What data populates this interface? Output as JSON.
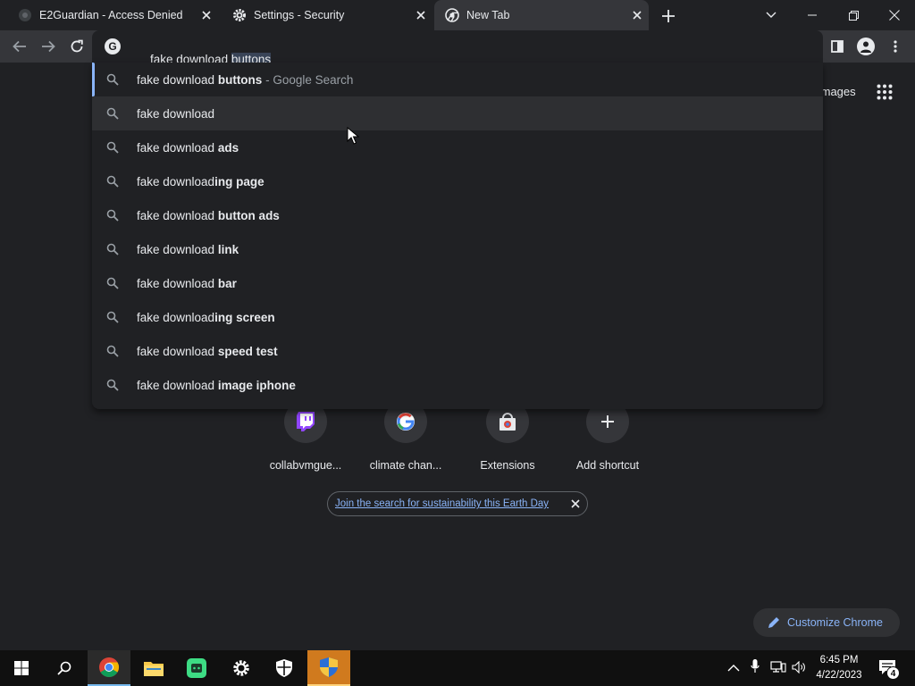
{
  "tabs": [
    {
      "title": "E2Guardian - Access Denied",
      "icon": "e2guardian-icon"
    },
    {
      "title": "Settings - Security",
      "icon": "gear-icon"
    },
    {
      "title": "New Tab",
      "icon": "chrome-icon"
    }
  ],
  "omnibox": {
    "typed": "fake download ",
    "autocomplete": "buttons"
  },
  "suggestions": [
    {
      "plain": "fake download ",
      "bold": "buttons",
      "suffix": " - Google Search"
    },
    {
      "plain": "fake download",
      "bold": "",
      "suffix": ""
    },
    {
      "plain": "fake download ",
      "bold": "ads",
      "suffix": ""
    },
    {
      "plain": "fake download",
      "bold": "ing page",
      "suffix": ""
    },
    {
      "plain": "fake download ",
      "bold": "button ads",
      "suffix": ""
    },
    {
      "plain": "fake download ",
      "bold": "link",
      "suffix": ""
    },
    {
      "plain": "fake download ",
      "bold": "bar",
      "suffix": ""
    },
    {
      "plain": "fake download",
      "bold": "ing screen",
      "suffix": ""
    },
    {
      "plain": "fake download ",
      "bold": "speed test",
      "suffix": ""
    },
    {
      "plain": "fake download ",
      "bold": "image iphone",
      "suffix": ""
    }
  ],
  "header_links": {
    "images": "Images"
  },
  "shortcuts": [
    {
      "label": "collabvmgue...",
      "icon": "twitch-icon"
    },
    {
      "label": "climate chan...",
      "icon": "google-icon"
    },
    {
      "label": "Extensions",
      "icon": "chrome-webstore-icon"
    },
    {
      "label": "Add shortcut",
      "icon": "plus-icon"
    }
  ],
  "promo": {
    "text": "Join the search for sustainability this Earth Day"
  },
  "customize": {
    "label": "Customize Chrome"
  },
  "clock": {
    "time": "6:45 PM",
    "date": "4/22/2023"
  },
  "notifications": {
    "count": "4"
  },
  "colors": {
    "accent": "#8ab4f8",
    "bg": "#202124",
    "toolbar": "#35363a"
  }
}
